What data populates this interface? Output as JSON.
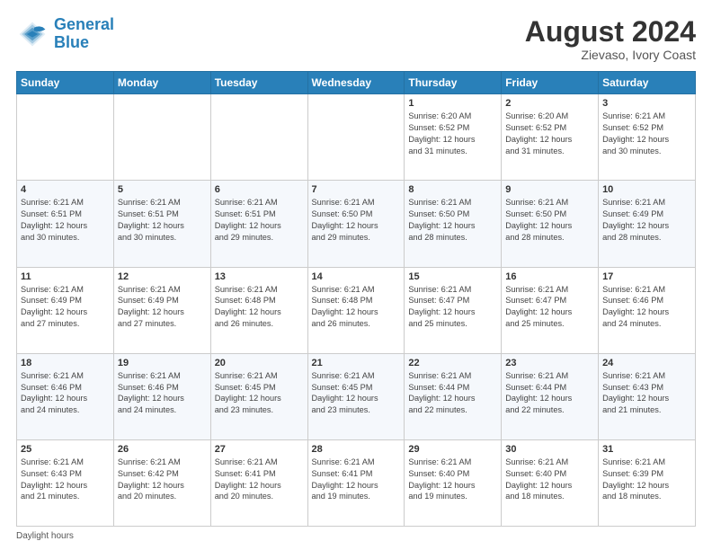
{
  "header": {
    "logo_line1": "General",
    "logo_line2": "Blue",
    "month": "August 2024",
    "location": "Zievaso, Ivory Coast"
  },
  "days_of_week": [
    "Sunday",
    "Monday",
    "Tuesday",
    "Wednesday",
    "Thursday",
    "Friday",
    "Saturday"
  ],
  "weeks": [
    [
      {
        "day": "",
        "info": ""
      },
      {
        "day": "",
        "info": ""
      },
      {
        "day": "",
        "info": ""
      },
      {
        "day": "",
        "info": ""
      },
      {
        "day": "1",
        "info": "Sunrise: 6:20 AM\nSunset: 6:52 PM\nDaylight: 12 hours\nand 31 minutes."
      },
      {
        "day": "2",
        "info": "Sunrise: 6:20 AM\nSunset: 6:52 PM\nDaylight: 12 hours\nand 31 minutes."
      },
      {
        "day": "3",
        "info": "Sunrise: 6:21 AM\nSunset: 6:52 PM\nDaylight: 12 hours\nand 30 minutes."
      }
    ],
    [
      {
        "day": "4",
        "info": "Sunrise: 6:21 AM\nSunset: 6:51 PM\nDaylight: 12 hours\nand 30 minutes."
      },
      {
        "day": "5",
        "info": "Sunrise: 6:21 AM\nSunset: 6:51 PM\nDaylight: 12 hours\nand 30 minutes."
      },
      {
        "day": "6",
        "info": "Sunrise: 6:21 AM\nSunset: 6:51 PM\nDaylight: 12 hours\nand 29 minutes."
      },
      {
        "day": "7",
        "info": "Sunrise: 6:21 AM\nSunset: 6:50 PM\nDaylight: 12 hours\nand 29 minutes."
      },
      {
        "day": "8",
        "info": "Sunrise: 6:21 AM\nSunset: 6:50 PM\nDaylight: 12 hours\nand 28 minutes."
      },
      {
        "day": "9",
        "info": "Sunrise: 6:21 AM\nSunset: 6:50 PM\nDaylight: 12 hours\nand 28 minutes."
      },
      {
        "day": "10",
        "info": "Sunrise: 6:21 AM\nSunset: 6:49 PM\nDaylight: 12 hours\nand 28 minutes."
      }
    ],
    [
      {
        "day": "11",
        "info": "Sunrise: 6:21 AM\nSunset: 6:49 PM\nDaylight: 12 hours\nand 27 minutes."
      },
      {
        "day": "12",
        "info": "Sunrise: 6:21 AM\nSunset: 6:49 PM\nDaylight: 12 hours\nand 27 minutes."
      },
      {
        "day": "13",
        "info": "Sunrise: 6:21 AM\nSunset: 6:48 PM\nDaylight: 12 hours\nand 26 minutes."
      },
      {
        "day": "14",
        "info": "Sunrise: 6:21 AM\nSunset: 6:48 PM\nDaylight: 12 hours\nand 26 minutes."
      },
      {
        "day": "15",
        "info": "Sunrise: 6:21 AM\nSunset: 6:47 PM\nDaylight: 12 hours\nand 25 minutes."
      },
      {
        "day": "16",
        "info": "Sunrise: 6:21 AM\nSunset: 6:47 PM\nDaylight: 12 hours\nand 25 minutes."
      },
      {
        "day": "17",
        "info": "Sunrise: 6:21 AM\nSunset: 6:46 PM\nDaylight: 12 hours\nand 24 minutes."
      }
    ],
    [
      {
        "day": "18",
        "info": "Sunrise: 6:21 AM\nSunset: 6:46 PM\nDaylight: 12 hours\nand 24 minutes."
      },
      {
        "day": "19",
        "info": "Sunrise: 6:21 AM\nSunset: 6:46 PM\nDaylight: 12 hours\nand 24 minutes."
      },
      {
        "day": "20",
        "info": "Sunrise: 6:21 AM\nSunset: 6:45 PM\nDaylight: 12 hours\nand 23 minutes."
      },
      {
        "day": "21",
        "info": "Sunrise: 6:21 AM\nSunset: 6:45 PM\nDaylight: 12 hours\nand 23 minutes."
      },
      {
        "day": "22",
        "info": "Sunrise: 6:21 AM\nSunset: 6:44 PM\nDaylight: 12 hours\nand 22 minutes."
      },
      {
        "day": "23",
        "info": "Sunrise: 6:21 AM\nSunset: 6:44 PM\nDaylight: 12 hours\nand 22 minutes."
      },
      {
        "day": "24",
        "info": "Sunrise: 6:21 AM\nSunset: 6:43 PM\nDaylight: 12 hours\nand 21 minutes."
      }
    ],
    [
      {
        "day": "25",
        "info": "Sunrise: 6:21 AM\nSunset: 6:43 PM\nDaylight: 12 hours\nand 21 minutes."
      },
      {
        "day": "26",
        "info": "Sunrise: 6:21 AM\nSunset: 6:42 PM\nDaylight: 12 hours\nand 20 minutes."
      },
      {
        "day": "27",
        "info": "Sunrise: 6:21 AM\nSunset: 6:41 PM\nDaylight: 12 hours\nand 20 minutes."
      },
      {
        "day": "28",
        "info": "Sunrise: 6:21 AM\nSunset: 6:41 PM\nDaylight: 12 hours\nand 19 minutes."
      },
      {
        "day": "29",
        "info": "Sunrise: 6:21 AM\nSunset: 6:40 PM\nDaylight: 12 hours\nand 19 minutes."
      },
      {
        "day": "30",
        "info": "Sunrise: 6:21 AM\nSunset: 6:40 PM\nDaylight: 12 hours\nand 18 minutes."
      },
      {
        "day": "31",
        "info": "Sunrise: 6:21 AM\nSunset: 6:39 PM\nDaylight: 12 hours\nand 18 minutes."
      }
    ]
  ],
  "footer": "Daylight hours"
}
